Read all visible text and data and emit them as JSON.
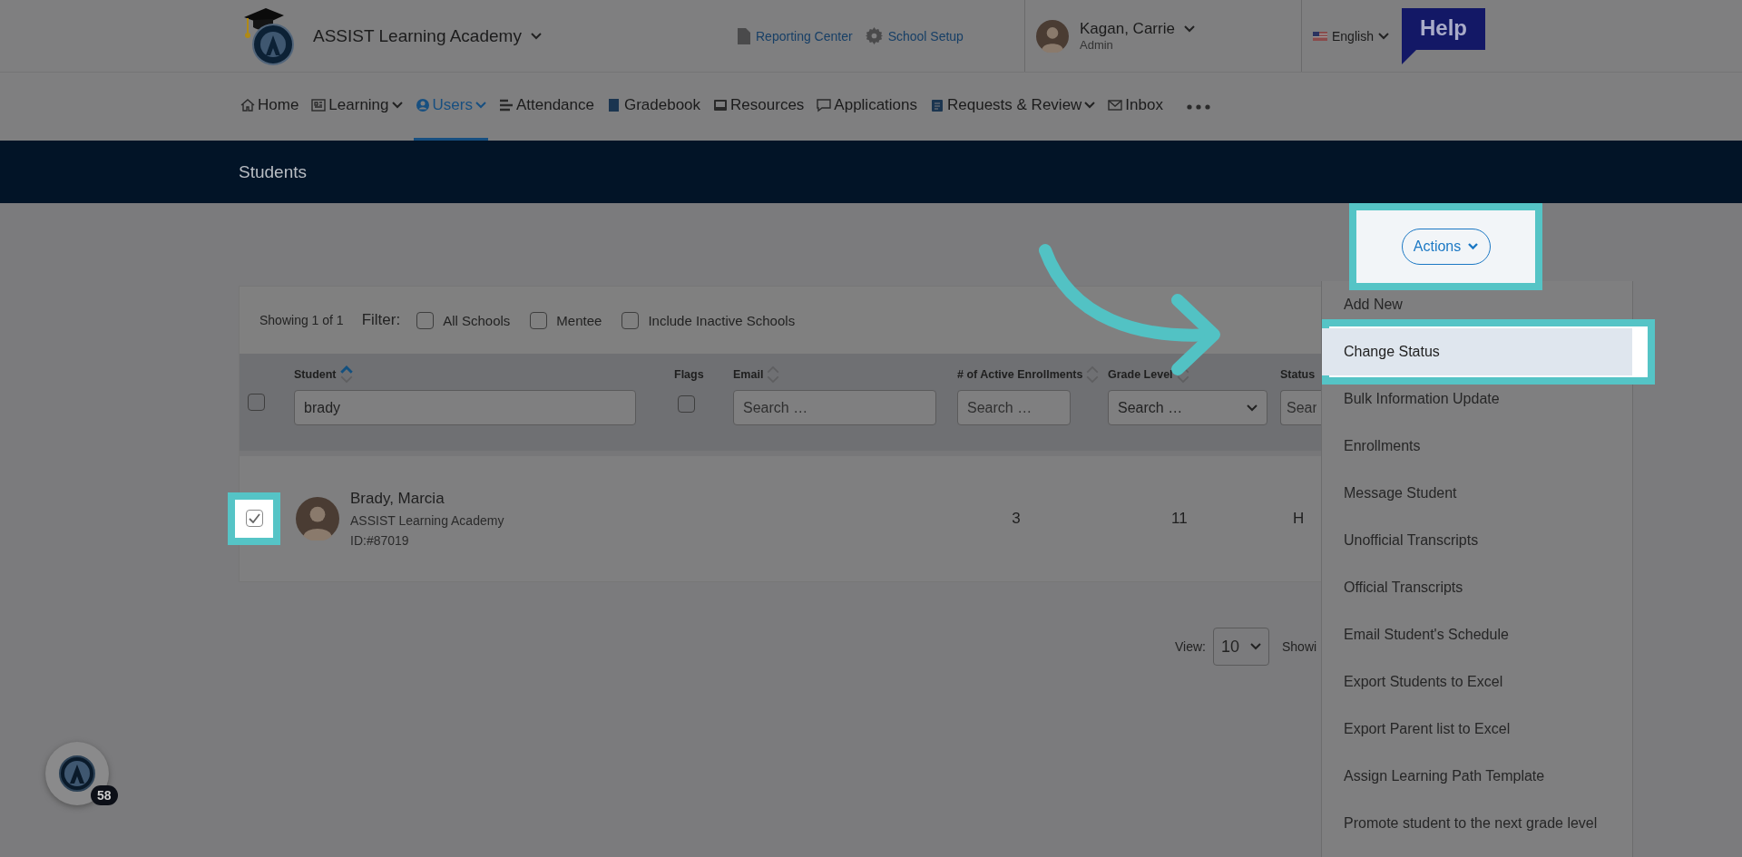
{
  "header": {
    "school": "ASSIST Learning Academy",
    "links": [
      {
        "label": "Reporting Center"
      },
      {
        "label": "School Setup"
      }
    ],
    "user": {
      "name": "Kagan, Carrie",
      "role": "Admin"
    },
    "language": "English",
    "help": "Help"
  },
  "nav": [
    {
      "label": "Home",
      "selected": false,
      "dropdown": false
    },
    {
      "label": "Learning",
      "selected": false,
      "dropdown": true
    },
    {
      "label": "Users",
      "selected": true,
      "dropdown": true
    },
    {
      "label": "Attendance",
      "selected": false,
      "dropdown": false
    },
    {
      "label": "Gradebook",
      "selected": false,
      "dropdown": false
    },
    {
      "label": "Resources",
      "selected": false,
      "dropdown": false
    },
    {
      "label": "Applications",
      "selected": false,
      "dropdown": false
    },
    {
      "label": "Requests & Review",
      "selected": false,
      "dropdown": true
    },
    {
      "label": "Inbox",
      "selected": false,
      "dropdown": false
    }
  ],
  "page_title": "Students",
  "actions": {
    "label": "Actions",
    "highlighted": true
  },
  "table": {
    "showing": "Showing 1 of 1",
    "filter_label": "Filter:",
    "filters": [
      {
        "label": "All Schools",
        "checked": false
      },
      {
        "label": "Mentee",
        "checked": false
      },
      {
        "label": "Include Inactive Schools",
        "checked": false
      }
    ],
    "select_all": {
      "checked": false
    },
    "columns": [
      {
        "label": "Student",
        "sort_active": true,
        "kind": "text",
        "value": "brady"
      },
      {
        "label": "Flags",
        "kind": "checkbox",
        "checked": false
      },
      {
        "label": "Email",
        "sort_active": false,
        "kind": "text",
        "placeholder": "Search …"
      },
      {
        "label": "# of Active Enrollments",
        "sort_active": false,
        "kind": "text",
        "placeholder": "Search …"
      },
      {
        "label": "Grade Level",
        "sort_active": false,
        "kind": "select",
        "placeholder": "Search …"
      },
      {
        "label": "Status",
        "kind": "text",
        "placeholder": "Sear"
      }
    ],
    "rows": [
      {
        "checked": true,
        "highlighted": true,
        "name": "Brady, Marcia",
        "school": "ASSIST Learning Academy",
        "id": "ID:#87019",
        "enrollments": "3",
        "grade_level": "11",
        "status": "H"
      }
    ]
  },
  "pagination": {
    "view_label": "View:",
    "page_size": "10",
    "showing": "Showi"
  },
  "menu": {
    "items": [
      {
        "label": "Add New",
        "selected": false
      },
      {
        "label": "Change Status",
        "selected": true
      },
      {
        "label": "Bulk Information Update",
        "selected": false
      },
      {
        "label": "Enrollments",
        "selected": false
      },
      {
        "label": "Message Student",
        "selected": false
      },
      {
        "label": "Unofficial Transcripts",
        "selected": false
      },
      {
        "label": "Official Transcripts",
        "selected": false
      },
      {
        "label": "Email Student's Schedule",
        "selected": false
      },
      {
        "label": "Export Students to Excel",
        "selected": false
      },
      {
        "label": "Export Parent list to Excel",
        "selected": false
      },
      {
        "label": "Assign Learning Path Template",
        "selected": false
      },
      {
        "label": "Promote student to the next grade level",
        "selected": false
      }
    ]
  },
  "chat_badge": "58"
}
